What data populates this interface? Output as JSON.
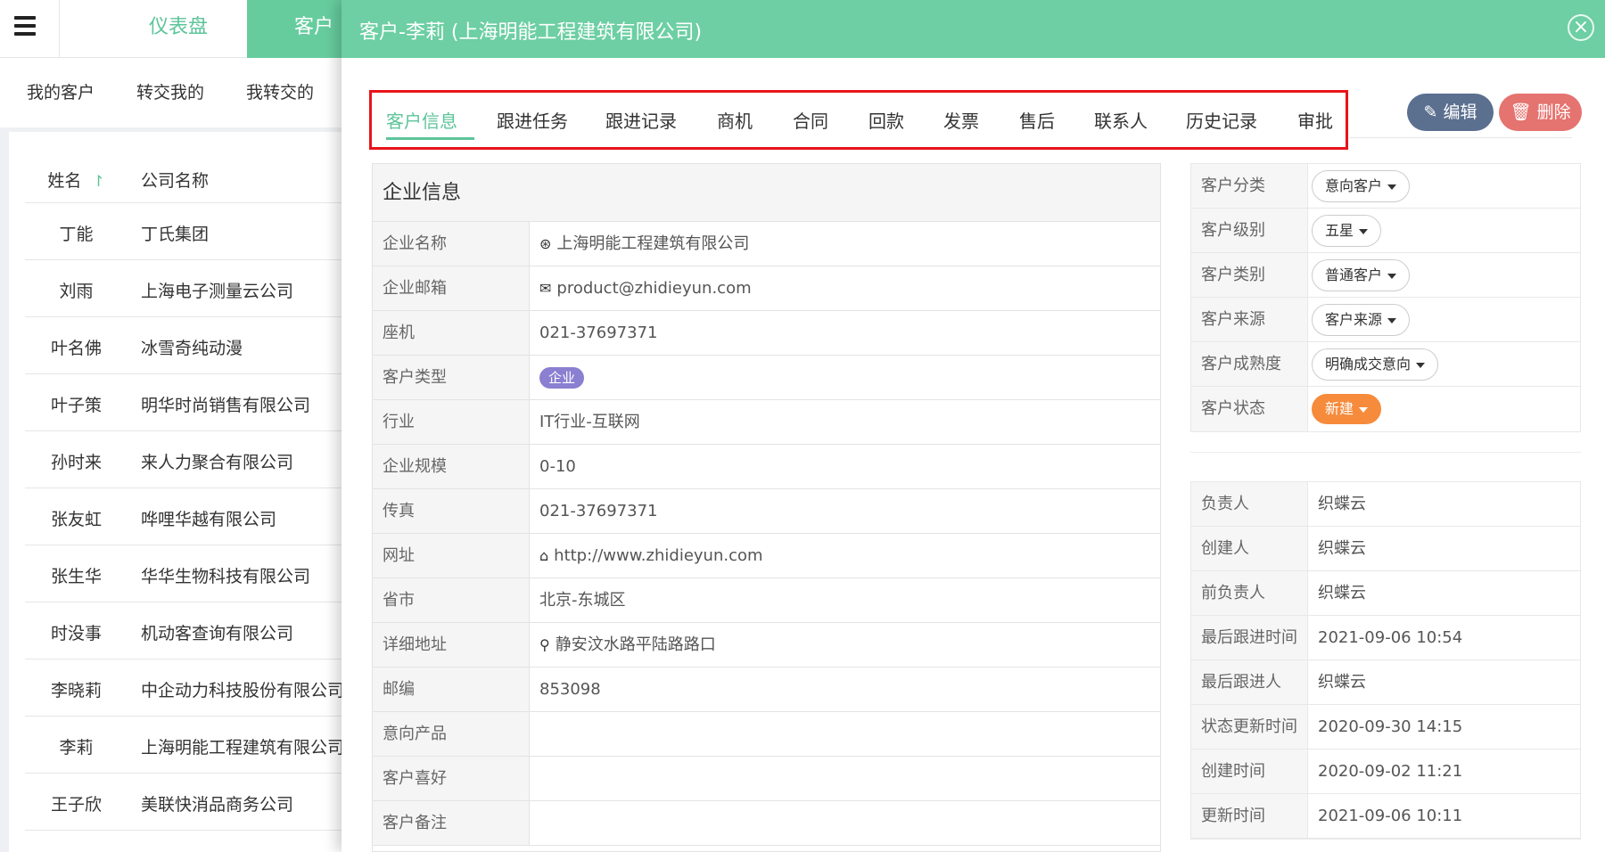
{
  "app": {
    "nav_dashboard": "仪表盘",
    "nav_customer": "客户",
    "subnav": [
      "我的客户",
      "转交我的",
      "我转交的"
    ]
  },
  "customer_list": {
    "col_name": "姓名",
    "col_company": "公司名称",
    "sort_icon": "↾",
    "rows": [
      {
        "name": "丁能",
        "company": "丁氏集团"
      },
      {
        "name": "刘雨",
        "company": "上海电子测量云公司"
      },
      {
        "name": "叶名佛",
        "company": "冰雪奇纯动漫"
      },
      {
        "name": "叶子策",
        "company": "明华时尚销售有限公司"
      },
      {
        "name": "孙时来",
        "company": "来人力聚合有限公司"
      },
      {
        "name": "张友虹",
        "company": "哗哩华越有限公司"
      },
      {
        "name": "张生华",
        "company": "华华生物科技有限公司"
      },
      {
        "name": "时没事",
        "company": "机动客查询有限公司"
      },
      {
        "name": "李晓莉",
        "company": "中企动力科技股份有限公司"
      },
      {
        "name": "李莉",
        "company": "上海明能工程建筑有限公司"
      },
      {
        "name": "王子欣",
        "company": "美联快消品商务公司"
      }
    ]
  },
  "modal": {
    "title": "客户-李莉 (上海明能工程建筑有限公司)",
    "close_glyph": "×",
    "tabs": [
      "客户信息",
      "跟进任务",
      "跟进记录",
      "商机",
      "合同",
      "回款",
      "发票",
      "售后",
      "联系人",
      "历史记录",
      "审批"
    ],
    "active_tab": "客户信息",
    "edit_label": "编辑",
    "delete_label": "删除"
  },
  "enterprise": {
    "section_title": "企业信息",
    "fields": [
      {
        "label": "企业名称",
        "value": "上海明能工程建筑有限公司",
        "icon": "dribbble-icon"
      },
      {
        "label": "企业邮箱",
        "value": "product@zhidieyun.com",
        "icon": "envelope-icon"
      },
      {
        "label": "座机",
        "value": "021-37697371"
      },
      {
        "label": "客户类型",
        "value": "企业",
        "badge": true
      },
      {
        "label": "行业",
        "value": "IT行业-互联网"
      },
      {
        "label": "企业规模",
        "value": "0-10"
      },
      {
        "label": "传真",
        "value": "021-37697371"
      },
      {
        "label": "网址",
        "value": "http://www.zhidieyun.com",
        "icon": "home-icon"
      },
      {
        "label": "省市",
        "value": "北京-东城区"
      },
      {
        "label": "详细地址",
        "value": "静安汶水路平陆路路口",
        "icon": "map-marker-icon"
      },
      {
        "label": "邮编",
        "value": "853098"
      },
      {
        "label": "意向产品",
        "value": ""
      },
      {
        "label": "客户喜好",
        "value": ""
      },
      {
        "label": "客户备注",
        "value": ""
      }
    ]
  },
  "classification": [
    {
      "label": "客户分类",
      "value": "意向客户"
    },
    {
      "label": "客户级别",
      "value": "五星"
    },
    {
      "label": "客户类别",
      "value": "普通客户"
    },
    {
      "label": "客户来源",
      "value": "客户来源"
    },
    {
      "label": "客户成熟度",
      "value": "明确成交意向"
    },
    {
      "label": "客户状态",
      "value": "新建",
      "accent": "#f68b3c"
    }
  ],
  "meta": [
    {
      "label": "负责人",
      "value": "织蝶云"
    },
    {
      "label": "创建人",
      "value": "织蝶云"
    },
    {
      "label": "前负责人",
      "value": "织蝶云"
    },
    {
      "label": "最后跟进时间",
      "value": "2021-09-06 10:54"
    },
    {
      "label": "最后跟进人",
      "value": "织蝶云"
    },
    {
      "label": "状态更新时间",
      "value": "2020-09-30 14:15"
    },
    {
      "label": "创建时间",
      "value": "2020-09-02 11:21"
    },
    {
      "label": "更新时间",
      "value": "2021-09-06 10:11"
    }
  ],
  "colors": {
    "brand_green": "#6dcfa3",
    "active_tab": "#5dc49a",
    "highlight_border": "#e8141a",
    "edit_button": "#5b6f8f",
    "delete_button": "#e5736f",
    "badge_purple": "#8a7fd0",
    "status_orange": "#f68b3c"
  }
}
